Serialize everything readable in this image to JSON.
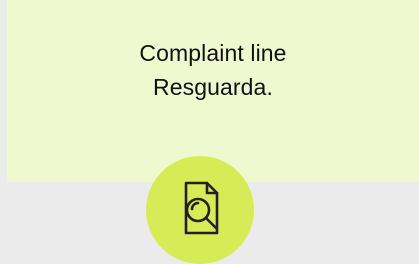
{
  "card": {
    "title_line_1": "Complaint line",
    "title_line_2": "Resguarda.",
    "icon": "document-search-icon",
    "colors": {
      "page_background": "#ebebeb",
      "card_background": "#f0f8cf",
      "icon_background": "#d6ec56",
      "icon_stroke": "#222222"
    }
  }
}
